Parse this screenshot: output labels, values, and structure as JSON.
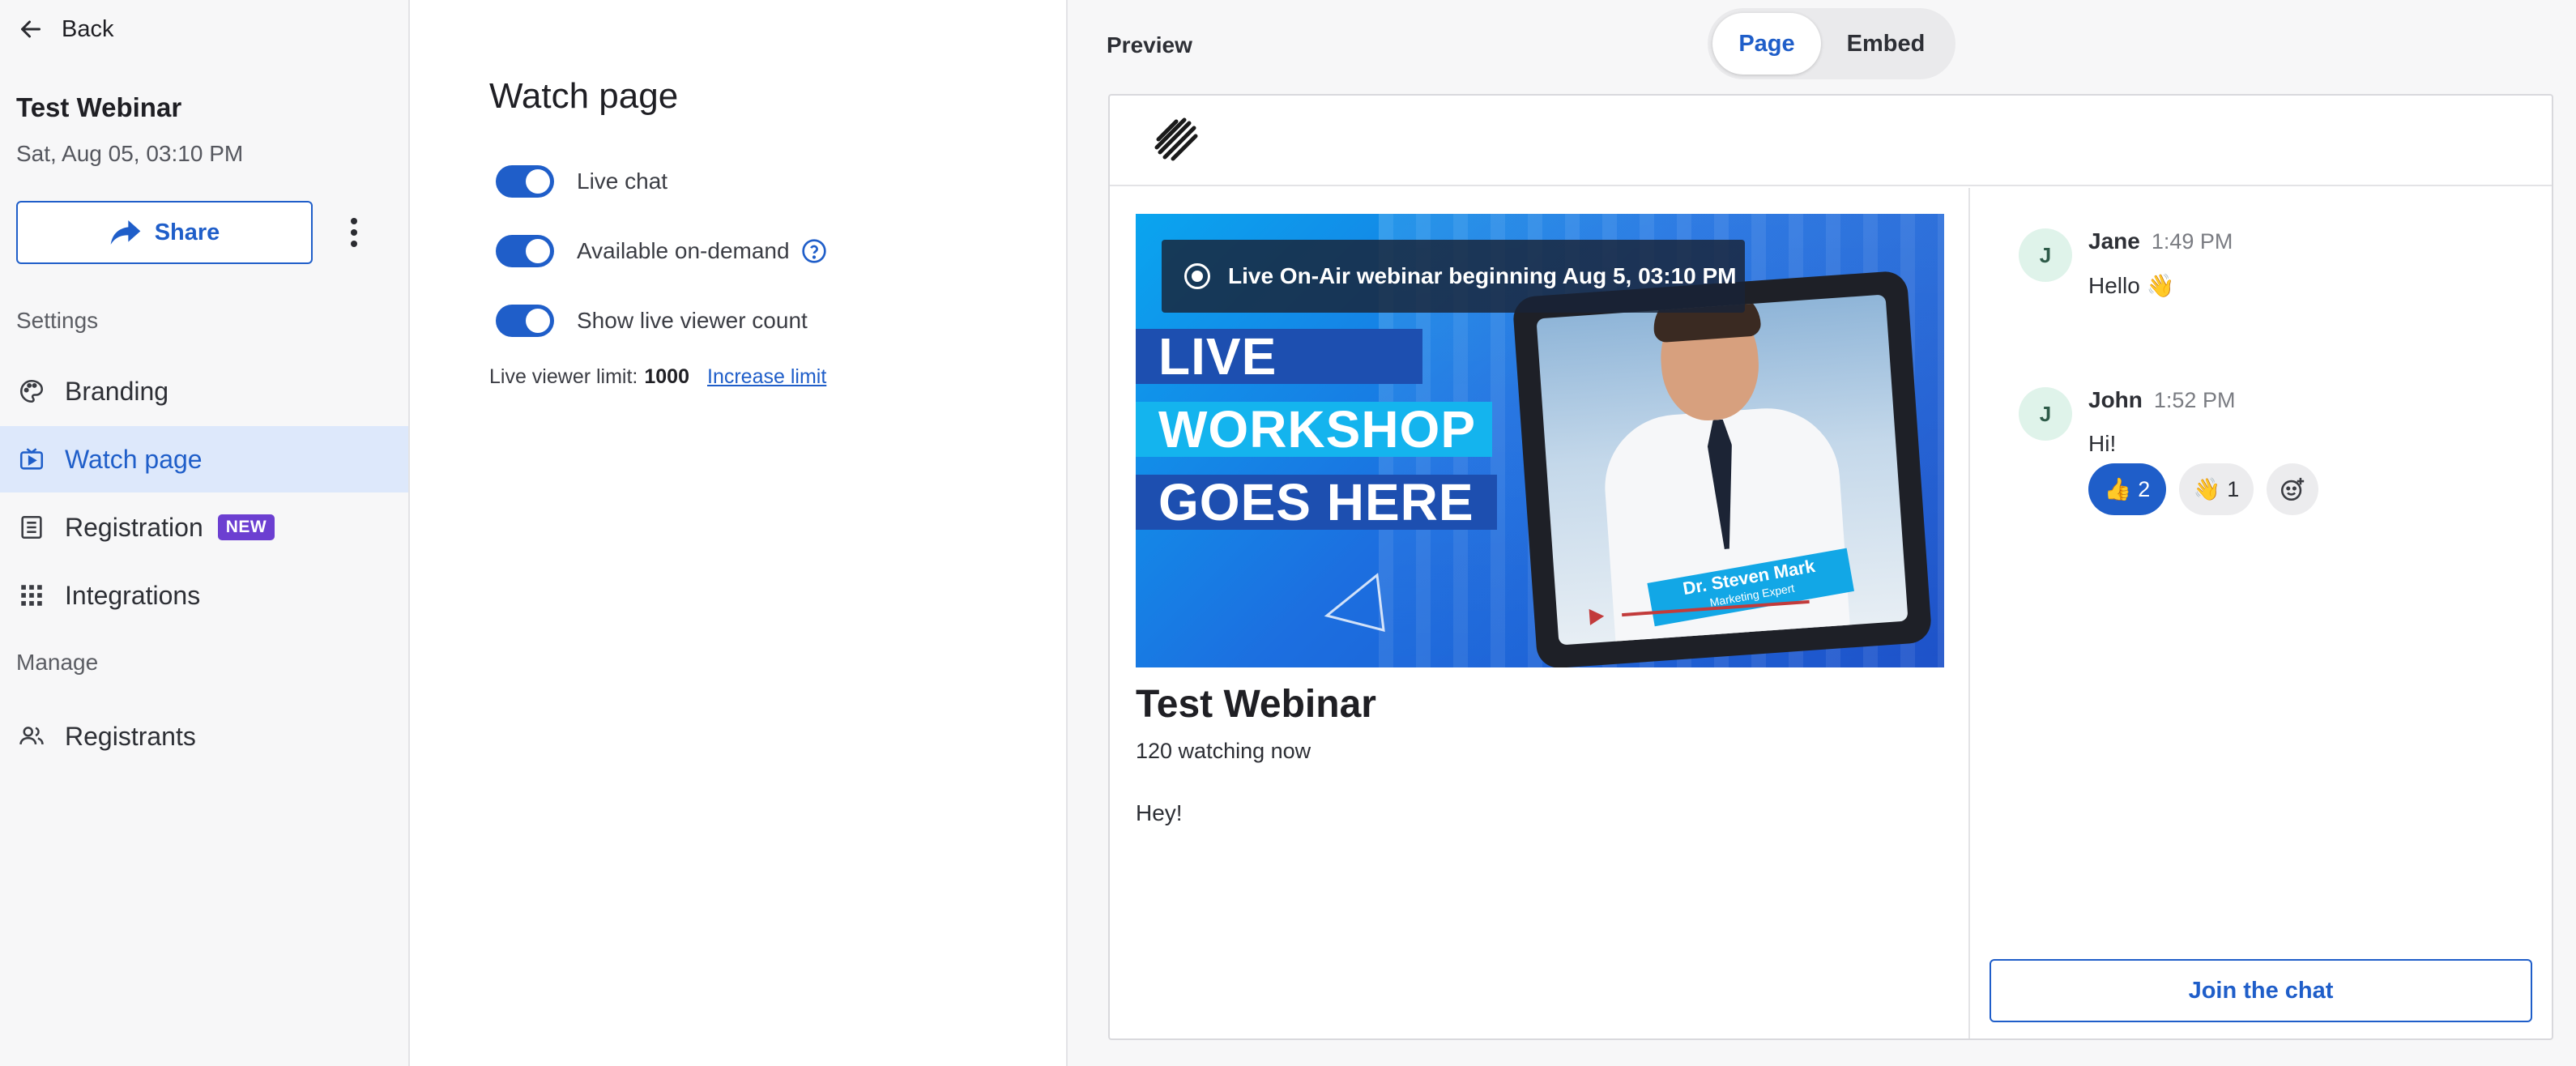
{
  "sidebar": {
    "back_label": "Back",
    "webinar_title": "Test Webinar",
    "webinar_date": "Sat, Aug 05, 03:10 PM",
    "share_label": "Share",
    "settings_heading": "Settings",
    "manage_heading": "Manage",
    "items": [
      {
        "label": "Branding",
        "icon": "palette-icon",
        "active": false
      },
      {
        "label": "Watch page",
        "icon": "monitor-play-icon",
        "active": true
      },
      {
        "label": "Registration",
        "icon": "form-list-icon",
        "active": false,
        "badge": "NEW"
      },
      {
        "label": "Integrations",
        "icon": "grid-dots-icon",
        "active": false
      }
    ],
    "manage_items": [
      {
        "label": "Registrants",
        "icon": "people-icon"
      }
    ]
  },
  "settings": {
    "title": "Watch page",
    "toggles": [
      {
        "label": "Live chat",
        "on": true
      },
      {
        "label": "Available on-demand",
        "on": true,
        "help": true
      },
      {
        "label": "Show live viewer count",
        "on": true
      }
    ],
    "limit_label": "Live viewer limit:",
    "limit_value": "1000",
    "increase_link": "Increase limit"
  },
  "preview": {
    "title": "Preview",
    "tabs": [
      {
        "label": "Page",
        "selected": true
      },
      {
        "label": "Embed",
        "selected": false
      }
    ],
    "video": {
      "banner": "Live On-Air webinar beginning Aug 5, 03:10 PM",
      "promo_lines": [
        "LIVE",
        "WORKSHOP",
        "GOES HERE"
      ],
      "speaker_name": "Dr. Steven Mark",
      "speaker_role": "Marketing Expert"
    },
    "event_title": "Test Webinar",
    "watching": "120 watching now",
    "description": "Hey!",
    "chat": {
      "messages": [
        {
          "initial": "J",
          "name": "Jane",
          "time": "1:49 PM",
          "text": "Hello 👋"
        },
        {
          "initial": "J",
          "name": "John",
          "time": "1:52 PM",
          "text": "Hi!",
          "reactions": [
            {
              "emoji": "👍",
              "count": "2",
              "selected": true
            },
            {
              "emoji": "👋",
              "count": "1",
              "selected": false
            }
          ]
        }
      ],
      "join_label": "Join the chat"
    }
  },
  "colors": {
    "accent": "#1f5ec9",
    "badge_new": "#6c3fd1",
    "active_nav_bg": "#dde8fb",
    "sidebar_bg": "#f7f7f8"
  }
}
